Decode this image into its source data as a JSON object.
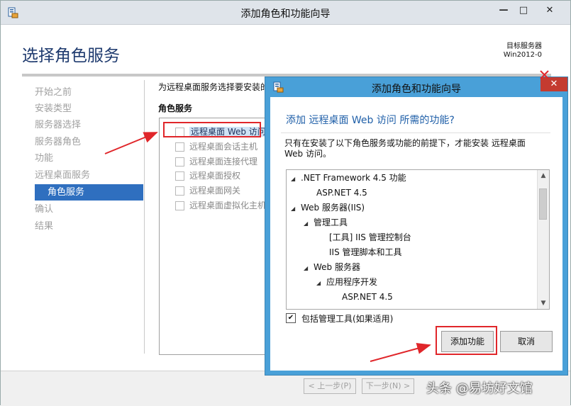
{
  "main_window": {
    "title": "添加角色和功能向导",
    "heading": "选择角色服务",
    "destination_label": "目标服务器",
    "destination_value": "Win2012-0",
    "nav_items": [
      {
        "label": "开始之前",
        "active": false
      },
      {
        "label": "安装类型",
        "active": false
      },
      {
        "label": "服务器选择",
        "active": false
      },
      {
        "label": "服务器角色",
        "active": false
      },
      {
        "label": "功能",
        "active": false
      },
      {
        "label": "远程桌面服务",
        "active": false
      },
      {
        "label": "角色服务",
        "active": true
      },
      {
        "label": "确认",
        "active": false
      },
      {
        "label": "结果",
        "active": false
      }
    ],
    "description": "为远程桌面服务选择要安装的",
    "roles_label": "角色服务",
    "roles": [
      "远程桌面 Web 访问",
      "远程桌面会话主机",
      "远程桌面连接代理",
      "远程桌面授权",
      "远程桌面网关",
      "远程桌面虚拟化主机"
    ],
    "prev_button": "< 上一步(P)",
    "next_button": "下一步(N) >",
    "window_buttons": {
      "min": "—",
      "max": "□",
      "close": "✕"
    }
  },
  "dialog": {
    "title": "添加角色和功能向导",
    "close": "✕",
    "question": "添加 远程桌面 Web 访问 所需的功能?",
    "info": "只有在安装了以下角色服务或功能的前提下，才能安装 远程桌面 Web 访问。",
    "tree": [
      {
        "label": ".NET Framework 4.5 功能",
        "level": 0,
        "expander": true
      },
      {
        "label": "ASP.NET 4.5",
        "level": 1,
        "expander": false
      },
      {
        "label": "Web 服务器(IIS)",
        "level": 0,
        "expander": true
      },
      {
        "label": "管理工具",
        "level": 1,
        "expander": true
      },
      {
        "label": "[工具] IIS 管理控制台",
        "level": 2,
        "expander": false
      },
      {
        "label": "IIS 管理脚本和工具",
        "level": 2,
        "expander": false
      },
      {
        "label": "Web 服务器",
        "level": 1,
        "expander": true
      },
      {
        "label": "应用程序开发",
        "level": 2,
        "expander": true
      },
      {
        "label": "ASP.NET 4.5",
        "level": 3,
        "expander": false
      }
    ],
    "include_tools": "包括管理工具(如果适用)",
    "include_checked": true,
    "add_button": "添加功能",
    "cancel_button": "取消"
  },
  "watermark": "头条 @易坊好文馆",
  "colors": {
    "accent_red": "#e0262a",
    "dialog_frame": "#49a0d8",
    "heading_blue": "#1e3a6e",
    "nav_active": "#2f6fbf"
  }
}
